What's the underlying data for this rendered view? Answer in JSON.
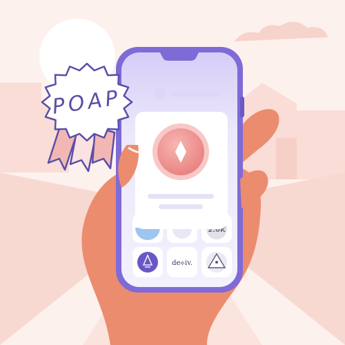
{
  "badge": {
    "label": "POAP",
    "colors": {
      "ink": "#5a4ea7",
      "ribbon": "#f2b7b4"
    }
  },
  "phone": {
    "frame_color": "#7e6bd6",
    "screen_color": "#ece8fb",
    "popup": {
      "token_icon": "diamond-icon",
      "token_color": "#ef8f8e"
    },
    "tiles": [
      {
        "label": "de⟡iv.",
        "icon": "devconnect-logo"
      },
      {
        "label": "2.0K",
        "icon": "token-count"
      }
    ]
  },
  "scene": {
    "background": "#fdf1ee",
    "hand_color": "#ec8c6f",
    "sun_color": "#ffffff"
  }
}
